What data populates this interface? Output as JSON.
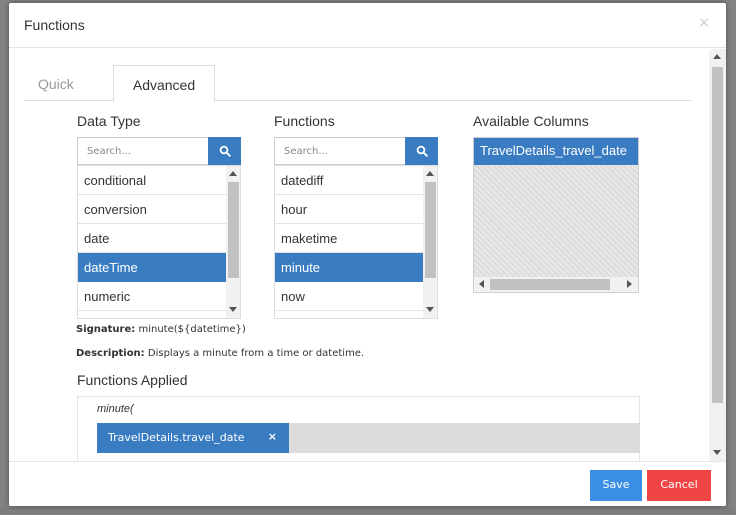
{
  "dialog": {
    "title": "Functions",
    "close": "×"
  },
  "tabs": [
    {
      "label": "Quick"
    },
    {
      "label": "Advanced"
    }
  ],
  "data_type": {
    "label": "Data Type",
    "search_placeholder": "Search...",
    "items": [
      "conditional",
      "conversion",
      "date",
      "dateTime",
      "numeric"
    ],
    "selected": "dateTime"
  },
  "functions": {
    "label": "Functions",
    "search_placeholder": "Search...",
    "items": [
      "datediff",
      "hour",
      "maketime",
      "minute",
      "now"
    ],
    "selected": "minute"
  },
  "available_columns": {
    "label": "Available Columns",
    "items": [
      "TravelDetails_travel_date"
    ]
  },
  "signature": {
    "label": "Signature:",
    "value": "minute(${datetime})"
  },
  "description": {
    "label": "Description:",
    "value": "Displays a minute from a time or datetime."
  },
  "functions_applied": {
    "label": "Functions Applied",
    "function_text": "minute(",
    "chip_label": "TravelDetails.travel_date",
    "chip_remove": "×"
  },
  "footer": {
    "save_label": "Save",
    "cancel_label": "Cancel"
  },
  "colors": {
    "accent": "#3a7cc2",
    "save": "#3a8ee6",
    "cancel": "#f04545"
  }
}
